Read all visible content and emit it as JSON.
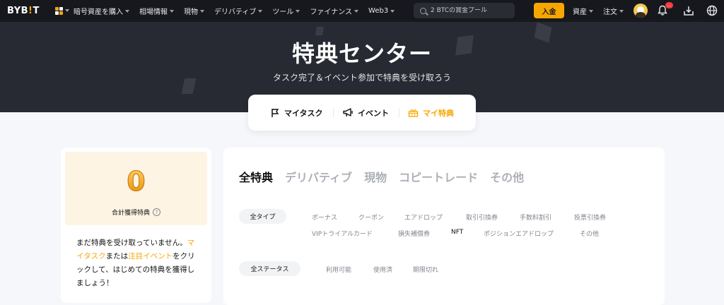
{
  "nav": {
    "logo_main": "BYB",
    "logo_accent": "!",
    "logo_tail": "T",
    "menu": [
      "暗号資産を購入",
      "相場情報",
      "現物",
      "デリバティブ",
      "ツール",
      "ファイナンス",
      "Web3"
    ],
    "search_placeholder": "2 BTCの賞金プール",
    "deposit": "入金",
    "assets": "資産",
    "orders": "注文",
    "badge": "..."
  },
  "hero": {
    "title": "特典センター",
    "subtitle": "タスク完了＆イベント参加で特典を受け取ろう"
  },
  "tabs": [
    {
      "label": "マイタスク"
    },
    {
      "label": "イベント"
    },
    {
      "label": "マイ特典"
    }
  ],
  "summary": {
    "count": "0",
    "total_label": "合計獲得特典",
    "help": "?",
    "msg_1": "まだ特典を受け取っていません。",
    "msg_link1": "マイタスク",
    "msg_2": "または",
    "msg_link2": "注目イベント",
    "msg_3": "をクリックして、はじめての特典を獲得しましょう！"
  },
  "categories": [
    "全特典",
    "デリバティブ",
    "現物",
    "コピートレード",
    "その他"
  ],
  "type_filter": {
    "selected": "全タイプ",
    "options_row1": [
      "ボーナス",
      "クーポン",
      "エアドロップ",
      "取引引換券",
      "手数料割引",
      "投票引換券"
    ],
    "options_row2": [
      "VIPトライアルカード",
      "損失補償券",
      "NFT",
      "ポジションエアドロップ",
      "その他"
    ]
  },
  "status_filter": {
    "selected": "全ステータス",
    "options": [
      "利用可能",
      "使用済",
      "期限切れ"
    ]
  },
  "colors": {
    "accent": "#f7a600",
    "nav_bg": "#17181e",
    "hero_bg": "#272a33"
  }
}
